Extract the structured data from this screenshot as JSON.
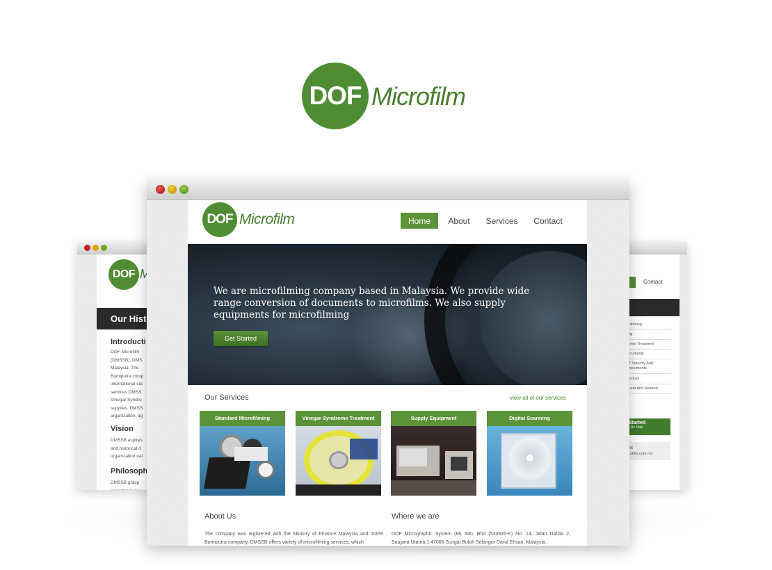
{
  "brand": {
    "logo_initials": "DOF",
    "logo_word": "Microfilm"
  },
  "nav": {
    "home": "Home",
    "about": "About",
    "services": "Services",
    "contact": "Contact"
  },
  "hero": {
    "text": "We are microfilming company based in Malaysia. We provide wide range conversion of documents to microfilms. We also supply equipments for microfilming",
    "button": "Get Started"
  },
  "services": {
    "title": "Our Services",
    "view_all": "view all of our services",
    "items": [
      {
        "label": "Standard Microfilming"
      },
      {
        "label": "Vinegar Syndrome Treatment"
      },
      {
        "label": "Supply Equipment"
      },
      {
        "label": "Digital Scanning"
      }
    ]
  },
  "about": {
    "heading": "About Us",
    "text": "The company was registered with the Ministry of Finance Malaysia and 100% Bumiputra company. DMSSB offers variety of microfilming services, which"
  },
  "where": {
    "heading": "Where we are",
    "text": "DOF Micrographic System (M) Sdn. Bhd (533926-K) No. 14, Jalan Dahlia 2, Saujana Utama 1 47000 Sungai Buloh Selangor Darul Ehsan, Malaysia."
  },
  "left_window": {
    "logo_initials": "DOF",
    "logo_word_partial": "M",
    "history_heading": "Our Histo",
    "intro_heading": "Introducti",
    "intro_lines": [
      "DOF Microfilm",
      "(DMSSB). DMS",
      "Malaysia. The",
      "Bumiputra comp",
      "international sta",
      "services DMSS",
      "Vinegar Syndro",
      "supplies. DMSS",
      "organization, ag"
    ],
    "vision_heading": "Vision",
    "vision_lines": [
      "DMSSB aspires",
      "and historical d",
      "organization nat"
    ],
    "philosophy_heading": "Philosoph",
    "philosophy_lines": [
      "DMSSB grasp",
      "microfilm to bec"
    ]
  },
  "right_window": {
    "contact": "Contact",
    "items": [
      "rofilming",
      "ing",
      "rome Treatment",
      "ocuments",
      "of Security And Documents",
      "ervices",
      "ment And Related"
    ],
    "button_title": "Started",
    "button_sub": "t Us Now",
    "contact_lines": [
      "36",
      "rofilm.com.my"
    ]
  },
  "colors": {
    "brand_green": "#4f8d35",
    "nav_active": "#5b9338",
    "dark_bar": "#2b2b2b",
    "dot_red": "#c0231c",
    "dot_yellow": "#d9a800",
    "dot_green": "#6aa821"
  },
  "icons": [
    "close-dot-icon",
    "minimize-dot-icon",
    "maximize-dot-icon"
  ]
}
